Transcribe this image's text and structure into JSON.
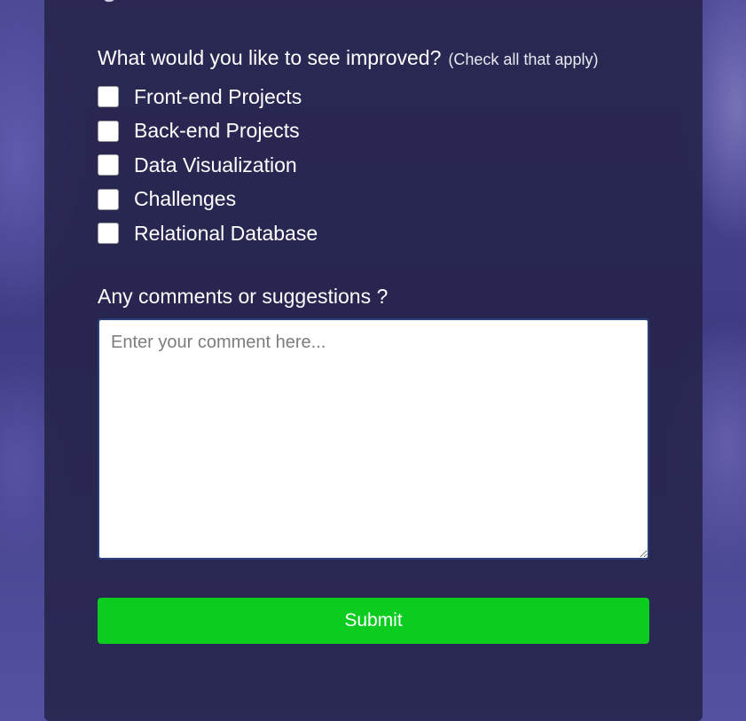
{
  "improve_section": {
    "question": "What would you like to see improved?",
    "hint": "(Check all that apply)",
    "options": [
      {
        "label": "Front-end Projects",
        "checked": false
      },
      {
        "label": "Back-end Projects",
        "checked": false
      },
      {
        "label": "Data Visualization",
        "checked": false
      },
      {
        "label": "Challenges",
        "checked": false
      },
      {
        "label": "Relational Database",
        "checked": false
      }
    ]
  },
  "comments": {
    "label": "Any comments or suggestions ?",
    "placeholder": "Enter your comment here...",
    "value": ""
  },
  "submit": {
    "label": "Submit"
  },
  "colors": {
    "card_background": "#242348",
    "submit_background": "#0ccc1f",
    "textarea_border": "#2b3f7a"
  }
}
